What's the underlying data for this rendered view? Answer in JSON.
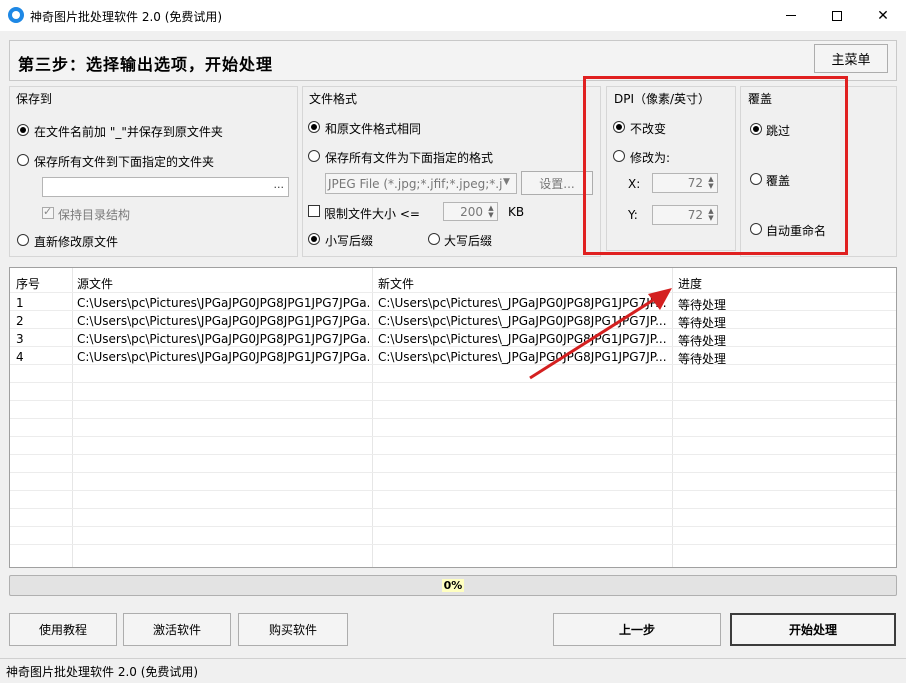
{
  "window": {
    "title": "神奇图片批处理软件 2.0 (免费试用)",
    "minimize": "—",
    "maximize": "□",
    "close": "✕"
  },
  "header": {
    "step_title": "第三步：选择输出选项，开始处理",
    "main_menu_label": "主菜单"
  },
  "save_to": {
    "title": "保存到",
    "option_prefix": "在文件名前加 \"_\"并保存到原文件夹",
    "option_folder": "保存所有文件到下面指定的文件夹",
    "folder_value": "",
    "browse": "...",
    "keep_structure": "保持目录结构",
    "option_overwrite": "直新修改原文件"
  },
  "file_format": {
    "title": "文件格式",
    "option_same": "和原文件格式相同",
    "option_specified": "保存所有文件为下面指定的格式",
    "format_value": "JPEG File (*.jpg;*.jfif;*.jpeg;*.j",
    "settings_label": "设置...",
    "limit_size_label": "限制文件大小  <=",
    "limit_size_value": "200",
    "limit_size_unit": "KB",
    "lowercase_ext": "小写后缀",
    "uppercase_ext": "大写后缀"
  },
  "dpi": {
    "title": "DPI（像素/英寸）",
    "keep": "不改变",
    "change_to": "修改为:",
    "x_label": "X:",
    "x_value": "72",
    "y_label": "Y:",
    "y_value": "72"
  },
  "overwrite": {
    "title": "覆盖",
    "skip": "跳过",
    "cover": "覆盖",
    "auto_rename": "自动重命名"
  },
  "table": {
    "headers": [
      "序号",
      "源文件",
      "新文件",
      "进度"
    ],
    "rows": [
      [
        "1",
        "C:\\Users\\pc\\Pictures\\JPGaJPG0JPG8JPG1JPG7JPGa...",
        "C:\\Users\\pc\\Pictures\\_JPGaJPG0JPG8JPG1JPG7JP...",
        "等待处理"
      ],
      [
        "2",
        "C:\\Users\\pc\\Pictures\\JPGaJPG0JPG8JPG1JPG7JPGa...",
        "C:\\Users\\pc\\Pictures\\_JPGaJPG0JPG8JPG1JPG7JP...",
        "等待处理"
      ],
      [
        "3",
        "C:\\Users\\pc\\Pictures\\JPGaJPG0JPG8JPG1JPG7JPGa...",
        "C:\\Users\\pc\\Pictures\\_JPGaJPG0JPG8JPG1JPG7JP...",
        "等待处理"
      ],
      [
        "4",
        "C:\\Users\\pc\\Pictures\\JPGaJPG0JPG8JPG1JPG7JPGa...",
        "C:\\Users\\pc\\Pictures\\_JPGaJPG0JPG8JPG1JPG7JP...",
        "等待处理"
      ]
    ]
  },
  "progress": {
    "percent": 0,
    "label": "0%"
  },
  "buttons": {
    "tutorial": "使用教程",
    "activate": "激活软件",
    "buy": "购买软件",
    "prev": "上一步",
    "start": "开始处理"
  },
  "status": {
    "text": "神奇图片批处理软件 2.0 (免费试用)"
  },
  "colors": {
    "highlight_box": "#e02020",
    "arrow": "#d42020",
    "progress_fill": "#06b025"
  }
}
